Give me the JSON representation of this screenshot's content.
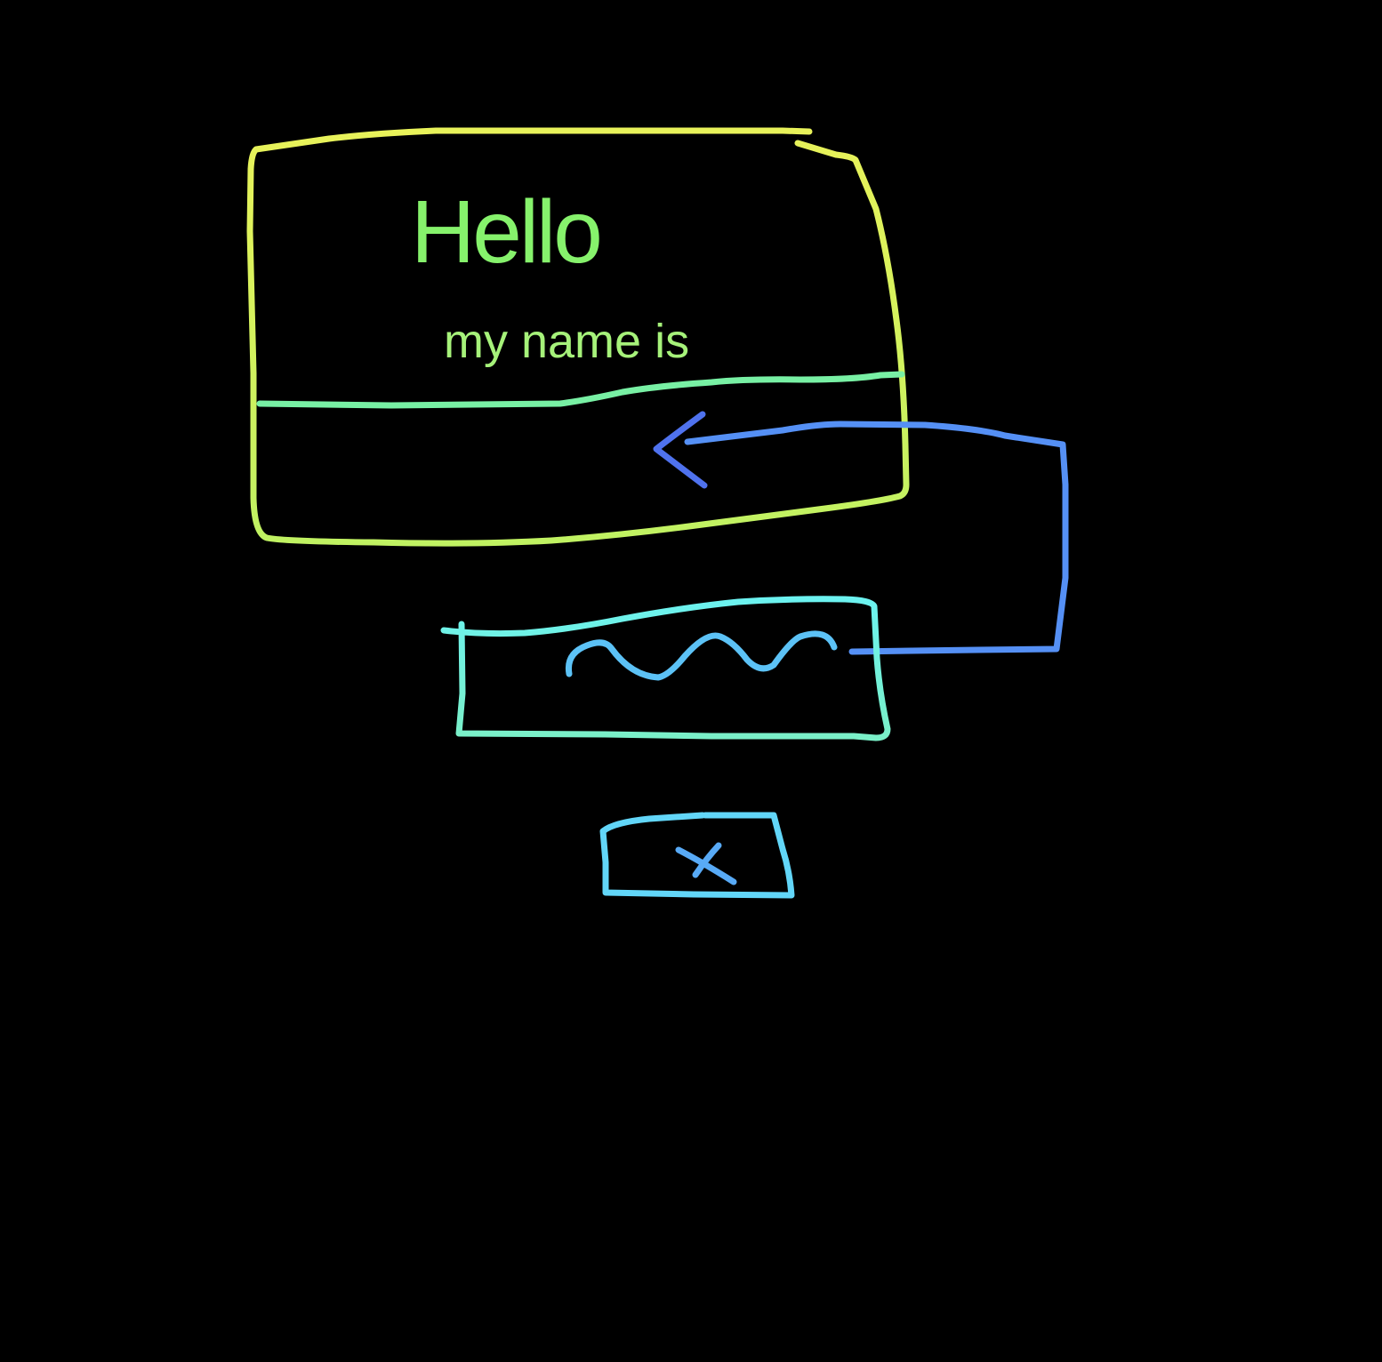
{
  "sketch": {
    "heading": "Hello",
    "subheading": "my name is",
    "colors": {
      "background": "#000000",
      "card_top": "#e6f25a",
      "card_border": "#c4f25e",
      "text": "#86f26c",
      "divider": "#78f0a4",
      "arrow": "#4f72ee",
      "connector": "#5590f5",
      "input_box": "#72f0dc",
      "scribble": "#5cc2f6",
      "close_box": "#62d6f8",
      "close_x": "#58aaf6"
    },
    "icons": {
      "back_arrow": "arrow-left-icon",
      "close": "close-icon"
    }
  }
}
